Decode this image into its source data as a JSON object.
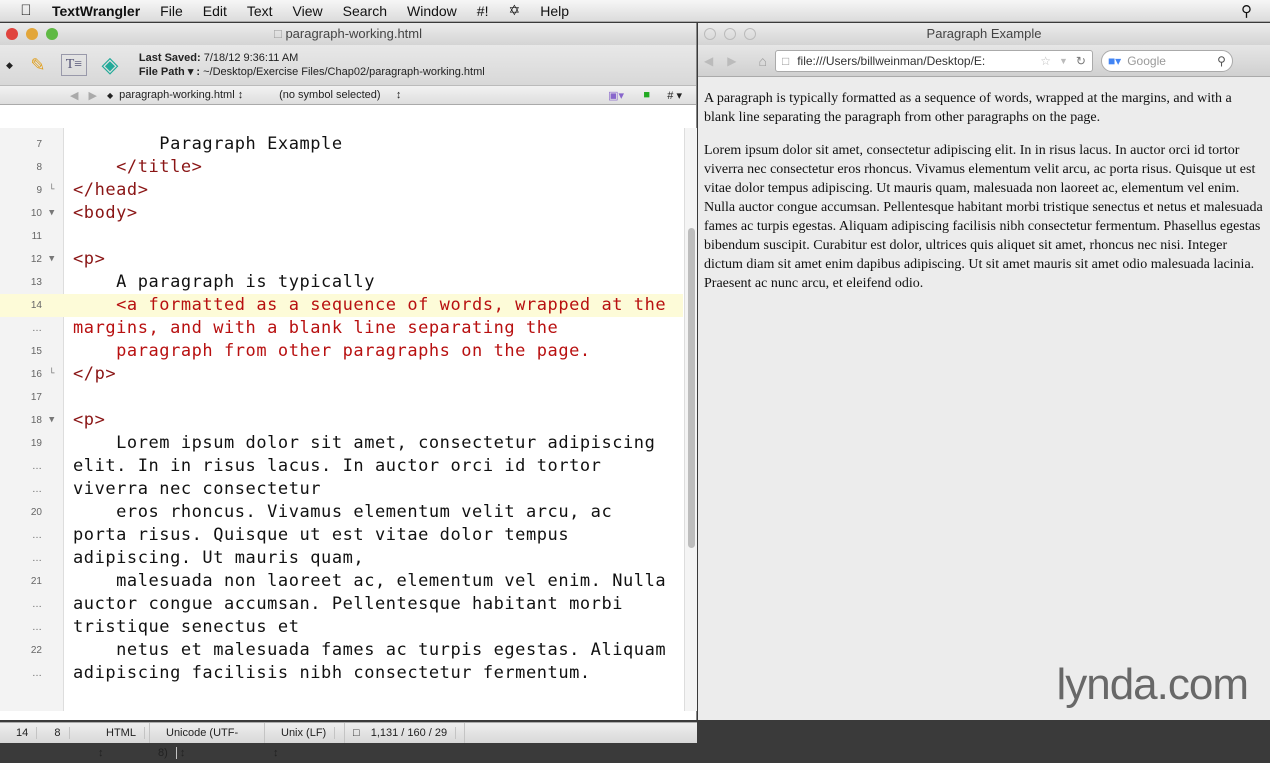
{
  "menubar": {
    "app": "TextWrangler",
    "items": [
      "File",
      "Edit",
      "Text",
      "View",
      "Search",
      "Window",
      "#!",
      "✡",
      "Help"
    ]
  },
  "editor": {
    "window_title": "paragraph-working.html",
    "last_saved_label": "Last Saved:",
    "last_saved": "7/18/12 9:36:11 AM",
    "file_path_label": "File Path ▾ :",
    "file_path": "~/Desktop/Exercise Files/Chap02/paragraph-working.html",
    "nav_file": "paragraph-working.html",
    "nav_symbol": "(no symbol selected)",
    "lines": [
      {
        "n": "7",
        "f": "",
        "c": "txt",
        "t": "        Paragraph Example"
      },
      {
        "n": "8",
        "f": "",
        "c": "tag",
        "t": "    </title>"
      },
      {
        "n": "9",
        "f": "└",
        "c": "tag",
        "t": "</head>"
      },
      {
        "n": "10",
        "f": "▼",
        "c": "tag",
        "t": "<body>"
      },
      {
        "n": "11",
        "f": "",
        "c": "txt",
        "t": ""
      },
      {
        "n": "12",
        "f": "▼",
        "c": "tag",
        "t": "<p>"
      },
      {
        "n": "13",
        "f": "",
        "c": "txt",
        "t": "    A paragraph is typically"
      },
      {
        "n": "14",
        "f": "",
        "c": "red",
        "t": "    <a formatted as a sequence of words, wrapped at the",
        "hl": true
      },
      {
        "n": "…",
        "f": "",
        "c": "red",
        "t": "margins, and with a blank line separating the"
      },
      {
        "n": "15",
        "f": "",
        "c": "red",
        "t": "    paragraph from other paragraphs on the page."
      },
      {
        "n": "16",
        "f": "└",
        "c": "tag",
        "t": "</p>"
      },
      {
        "n": "17",
        "f": "",
        "c": "txt",
        "t": ""
      },
      {
        "n": "18",
        "f": "▼",
        "c": "tag",
        "t": "<p>"
      },
      {
        "n": "19",
        "f": "",
        "c": "txt",
        "t": "    Lorem ipsum dolor sit amet, consectetur adipiscing"
      },
      {
        "n": "…",
        "f": "",
        "c": "txt",
        "t": "elit. In in risus lacus. In auctor orci id tortor"
      },
      {
        "n": "…",
        "f": "",
        "c": "txt",
        "t": "viverra nec consectetur"
      },
      {
        "n": "20",
        "f": "",
        "c": "txt",
        "t": "    eros rhoncus. Vivamus elementum velit arcu, ac"
      },
      {
        "n": "…",
        "f": "",
        "c": "txt",
        "t": "porta risus. Quisque ut est vitae dolor tempus"
      },
      {
        "n": "…",
        "f": "",
        "c": "txt",
        "t": "adipiscing. Ut mauris quam,"
      },
      {
        "n": "21",
        "f": "",
        "c": "txt",
        "t": "    malesuada non laoreet ac, elementum vel enim. Nulla"
      },
      {
        "n": "…",
        "f": "",
        "c": "txt",
        "t": "auctor congue accumsan. Pellentesque habitant morbi"
      },
      {
        "n": "…",
        "f": "",
        "c": "txt",
        "t": "tristique senectus et"
      },
      {
        "n": "22",
        "f": "",
        "c": "txt",
        "t": "    netus et malesuada fames ac turpis egestas. Aliquam"
      },
      {
        "n": "…",
        "f": "",
        "c": "txt",
        "t": "adipiscing facilisis nibh consectetur fermentum."
      }
    ],
    "status": {
      "line": "14",
      "col": "8",
      "language": "HTML",
      "encoding": "Unicode (UTF-8)",
      "line_endings": "Unix (LF)",
      "counts": "1,131 / 160 / 29"
    }
  },
  "browser": {
    "window_title": "Paragraph Example",
    "url": "file:///Users/billweinman/Desktop/E:",
    "search_placeholder": "Google",
    "paragraphs": [
      "A paragraph is typically formatted as a sequence of words, wrapped at the margins, and with a blank line separating the paragraph from other paragraphs on the page.",
      "Lorem ipsum dolor sit amet, consectetur adipiscing elit. In in risus lacus. In auctor orci id tortor viverra nec consectetur eros rhoncus. Vivamus elementum velit arcu, ac porta risus. Quisque ut est vitae dolor tempus adipiscing. Ut mauris quam, malesuada non laoreet ac, elementum vel enim. Nulla auctor congue accumsan. Pellentesque habitant morbi tristique senectus et netus et malesuada fames ac turpis egestas. Aliquam adipiscing facilisis nibh consectetur fermentum. Phasellus egestas bibendum suscipit. Curabitur est dolor, ultrices quis aliquet sit amet, rhoncus nec nisi. Integer dictum diam sit amet enim dapibus adipiscing. Ut sit amet mauris sit amet odio malesuada lacinia. Praesent ac nunc arcu, et eleifend odio."
    ]
  },
  "watermark": "lynda.com"
}
